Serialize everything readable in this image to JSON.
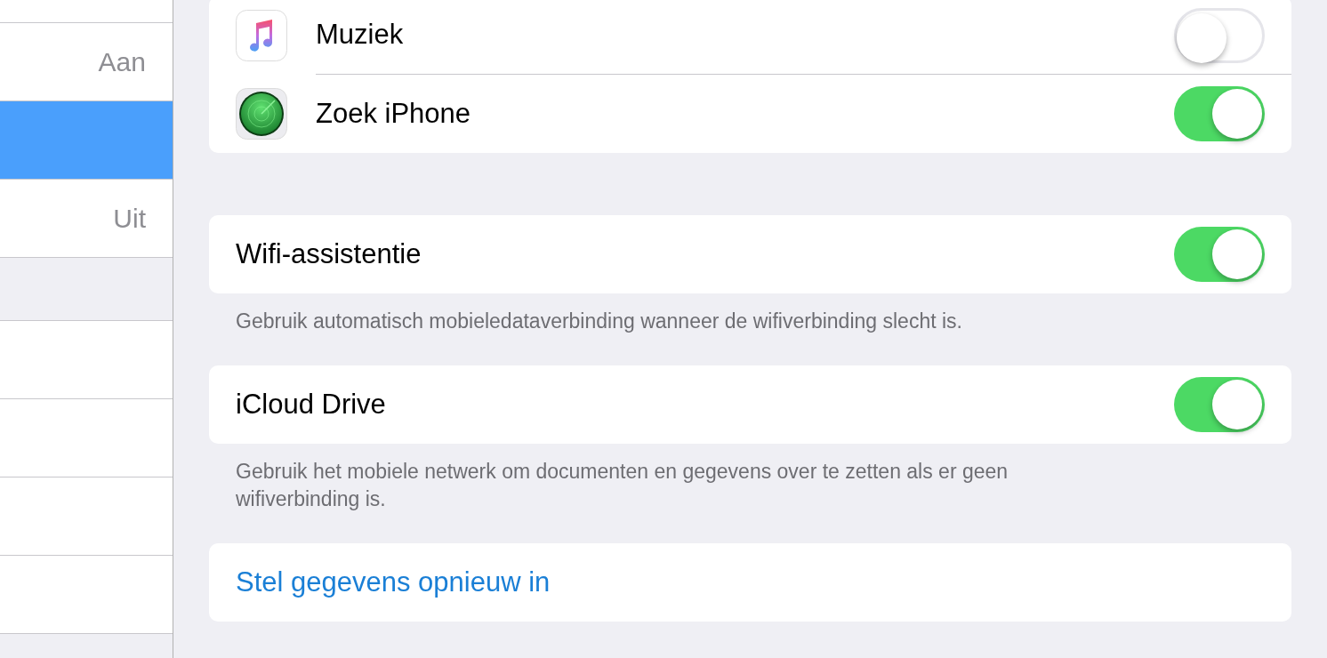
{
  "sidebar": {
    "groups": [
      {
        "items": [
          {
            "selected": false
          },
          {
            "value": "Aan",
            "selected": false
          },
          {
            "selected": true
          },
          {
            "value": "Uit",
            "selected": false
          }
        ]
      },
      {
        "items": [
          {
            "selected": false
          },
          {
            "selected": false
          },
          {
            "selected": false
          },
          {
            "selected": false
          }
        ]
      }
    ]
  },
  "sections": [
    {
      "rows": [
        {
          "kind": "app",
          "label": "Muziek",
          "on": false
        },
        {
          "kind": "app",
          "label": "Zoek iPhone",
          "on": true
        }
      ]
    },
    {
      "rows": [
        {
          "kind": "toggle",
          "label": "Wifi-assistentie",
          "on": true
        }
      ],
      "footer": "Gebruik automatisch mobieledataverbinding wanneer de wifiverbinding slecht is."
    },
    {
      "rows": [
        {
          "kind": "toggle",
          "label": "iCloud Drive",
          "on": true
        }
      ],
      "footer": "Gebruik het mobiele netwerk om documenten en gegevens over te zetten als er geen wifiverbinding is."
    },
    {
      "rows": [
        {
          "kind": "link",
          "label": "Stel gegevens opnieuw in"
        }
      ]
    }
  ]
}
